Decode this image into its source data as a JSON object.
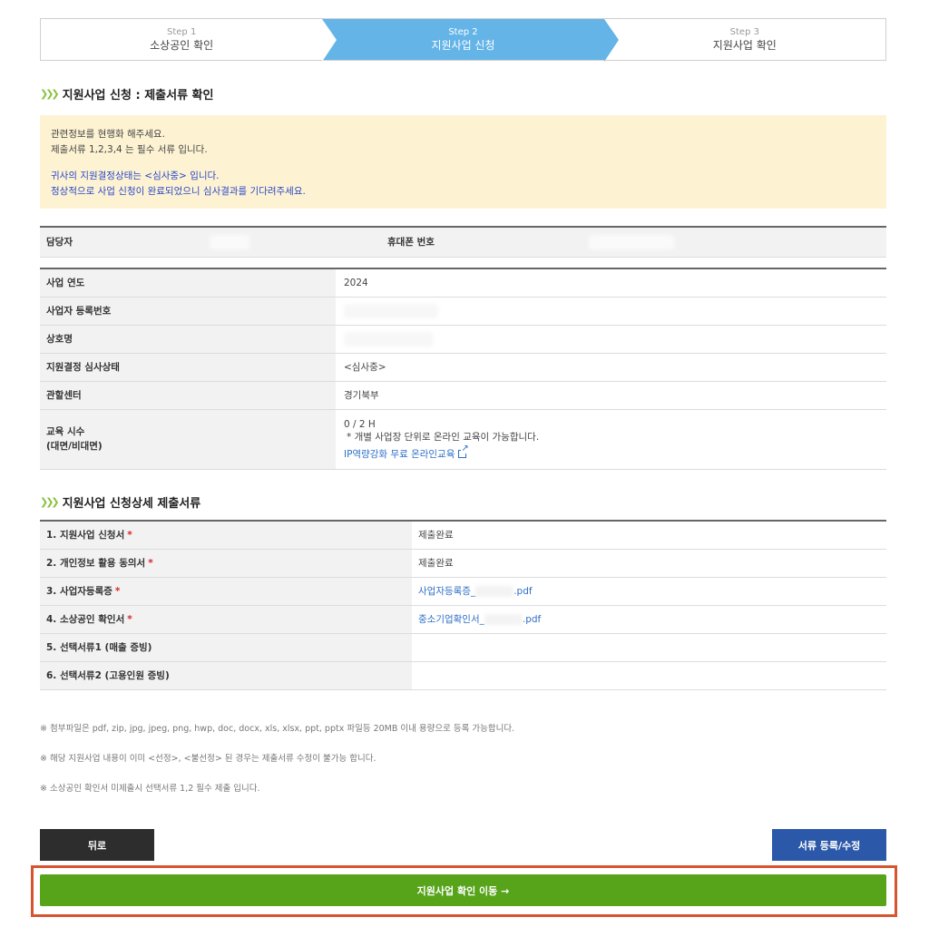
{
  "steps": [
    {
      "num": "Step 1",
      "label": "소상공인 확인"
    },
    {
      "num": "Step 2",
      "label": "지원사업 신청"
    },
    {
      "num": "Step 3",
      "label": "지원사업 확인"
    }
  ],
  "section1_title": "지원사업 신청 : 제출서류 확인",
  "notice": {
    "line1": "관련정보를 현행화 해주세요.",
    "line2": "제출서류 1,2,3,4 는 필수 서류 입니다.",
    "line3": "귀사의 지원결정상태는 <심사중> 입니다.",
    "line4": "정상적으로 사업 신청이 완료되었으니 심사결과를 기다려주세요."
  },
  "contact": {
    "manager_label": "담당자",
    "phone_label": "휴대폰 번호"
  },
  "info": {
    "year_label": "사업 연도",
    "year_value": "2024",
    "bizno_label": "사업자 등록번호",
    "company_label": "상호명",
    "status_label": "지원결정 심사상태",
    "status_value": "<심사중>",
    "center_label": "관할센터",
    "center_value": "경기북부",
    "edu_label": "교육 시수",
    "edu_label2": "(대면/비대면)",
    "edu_value": "0 / 2 H",
    "edu_note": "* 개별 사업장 단위로 온라인 교육이 가능합니다.",
    "edu_link": "IP역량강화 무료 온라인교육"
  },
  "section2_title": "지원사업 신청상세 제출서류",
  "docs": [
    {
      "label": "1. 지원사업 신청서",
      "required": "*",
      "value": "제출완료"
    },
    {
      "label": "2. 개인정보 활용 동의서",
      "required": "*",
      "value": "제출완료"
    },
    {
      "label": "3. 사업자등록증",
      "required": "*",
      "file_prefix": "사업자등록증_",
      "file_suffix": ".pdf"
    },
    {
      "label": "4. 소상공인 확인서",
      "required": "*",
      "file_prefix": "중소기업확인서_",
      "file_suffix": ".pdf"
    },
    {
      "label": "5. 선택서류1 (매출 증빙)"
    },
    {
      "label": "6. 선택서류2 (고용인원 증빙)"
    }
  ],
  "notes": [
    "※ 첨부파일은 pdf, zip, jpg, jpeg, png, hwp, doc, docx, xls, xlsx, ppt, pptx 파일등 20MB 이내 용량으로 등록 가능합니다.",
    "※ 해당 지원사업 내용이 이미 <선정>, <불선정> 된 경우는 제출서류 수정이 불가능 합니다.",
    "※ 소상공인 확인서 미제출시 선택서류 1,2 필수 제출 입니다."
  ],
  "buttons": {
    "back": "뒤로",
    "edit": "서류 등록/수정",
    "go": "지원사업 확인 이동 →"
  },
  "colors": {
    "step_active": "#64b4e8",
    "go_button": "#57a41b",
    "edit_button": "#2b58a9",
    "highlight": "#d7542f"
  }
}
